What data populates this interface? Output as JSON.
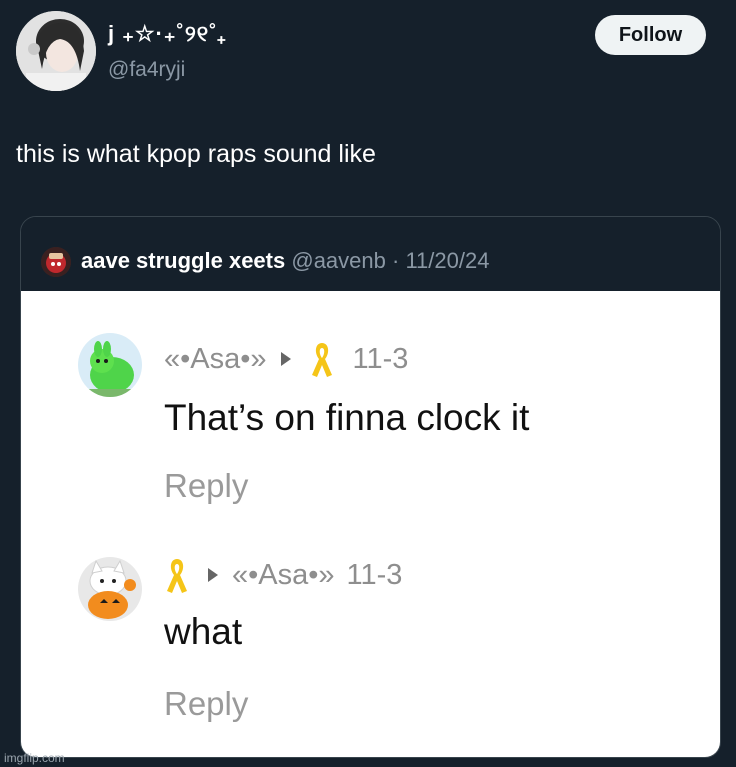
{
  "tweet": {
    "display_name": "j ₊☆·₊˚୨୧˚₊",
    "handle": "@fa4ryji",
    "follow_label": "Follow",
    "text": "this is what kpop raps sound like"
  },
  "quote": {
    "author_name": "aave struggle xeets",
    "author_handle": "@aavenb",
    "separator": "·",
    "date": "11/20/24",
    "comments": [
      {
        "user": "«•Asa•»",
        "date": "11-3",
        "text": "That’s on finna clock it",
        "reply_label": "Reply"
      },
      {
        "reply_to": "«•Asa•»",
        "date": "11-3",
        "text": "what",
        "reply_label": "Reply"
      }
    ]
  },
  "watermark": "imgflip.com",
  "colors": {
    "background": "#15202b",
    "secondary_text": "#8b98a5",
    "ribbon": "#f5c518"
  }
}
